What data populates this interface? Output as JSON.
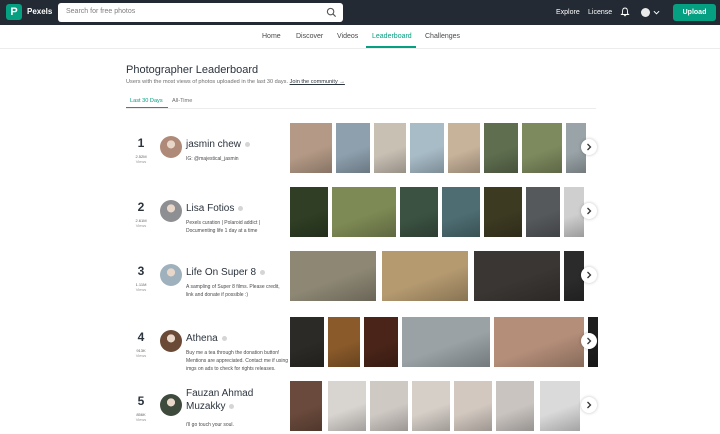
{
  "brand": {
    "name": "Pexels",
    "logo_letter": "P",
    "color": "#05a081"
  },
  "topbar": {
    "search_placeholder": "Search for free photos",
    "explore": "Explore",
    "license": "License",
    "upload": "Upload"
  },
  "subnav": [
    "Home",
    "Discover",
    "Videos",
    "Leaderboard",
    "Challenges"
  ],
  "page": {
    "title": "Photographer Leaderboard",
    "subtitle": "Users with the most views of photos uploaded in the last 30 days.",
    "join_link": "Join the community →",
    "tabs": [
      "Last 30 Days",
      "All-Time"
    ]
  },
  "views_label": "Views",
  "leaders": [
    {
      "rank": "1",
      "views": "2.52M",
      "name": "jasmin chew",
      "bio": "IG: @majestical_jasmin",
      "avatar_color": "#b08a78",
      "thumb_colors": [
        "#b49a86",
        "#8ea0ae",
        "#c9c0b4",
        "#a8bcc8",
        "#c7b29a",
        "#5f6e4f",
        "#7d8a5e",
        "#9aa4a8"
      ]
    },
    {
      "rank": "2",
      "views": "2.61M",
      "name": "Lisa Fotios",
      "bio": "Pexels curation | Polaroid addict | Documenting life 1 day at a time",
      "avatar_color": "#8e8f92",
      "thumb_colors": [
        "#2f3e24",
        "#7e8a55",
        "#3b5242",
        "#4d6d72",
        "#3d3a22",
        "#56595c",
        "#cfcfcf"
      ]
    },
    {
      "rank": "3",
      "views": "1.11M",
      "name": "Life On Super 8",
      "bio": "A sampling of Super 8 films. Please credit, link and donate if possible :)",
      "avatar_color": "#9fb1bd",
      "thumb_colors": [
        "#8d8774",
        "#b59a70",
        "#3a3633",
        "#2b2b2b"
      ]
    },
    {
      "rank": "4",
      "views": "913K",
      "name": "Athena",
      "bio": "Buy me a tea through the donation button! Mentions are appreciated. Contact me if using imgs on ads to check for rights releases.",
      "avatar_color": "#6a4a36",
      "thumb_colors": [
        "#2c2a26",
        "#8a5a2a",
        "#4a2418",
        "#9aa2a6",
        "#b48e79",
        "#1e1e1e",
        "#d8d8d8"
      ]
    },
    {
      "rank": "5",
      "views": "856K",
      "name": "Fauzan Ahmad Muzakky",
      "bio": "i'll go touch your soul.",
      "avatar_color": "#3e4a3c",
      "thumb_colors": [
        "#6a4a3c",
        "#d8d4d0",
        "#cfc9c4",
        "#d6cfc8",
        "#d2c8c0",
        "#c9c4c0",
        "#dadada"
      ]
    }
  ]
}
